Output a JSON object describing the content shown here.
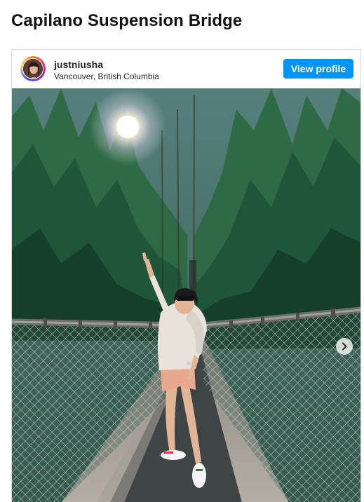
{
  "page": {
    "title": "Capilano Suspension Bridge"
  },
  "post": {
    "username": "justniusha",
    "location": "Vancouver, British Columbia",
    "view_profile_label": "View profile",
    "photo_alt": "Woman posing on Capilano Suspension Bridge surrounded by tall evergreen trees"
  },
  "icons": {
    "next": "chevron-right-icon"
  },
  "colors": {
    "accent": "#0095f6",
    "border": "#dbdbdb",
    "text": "#262626"
  }
}
